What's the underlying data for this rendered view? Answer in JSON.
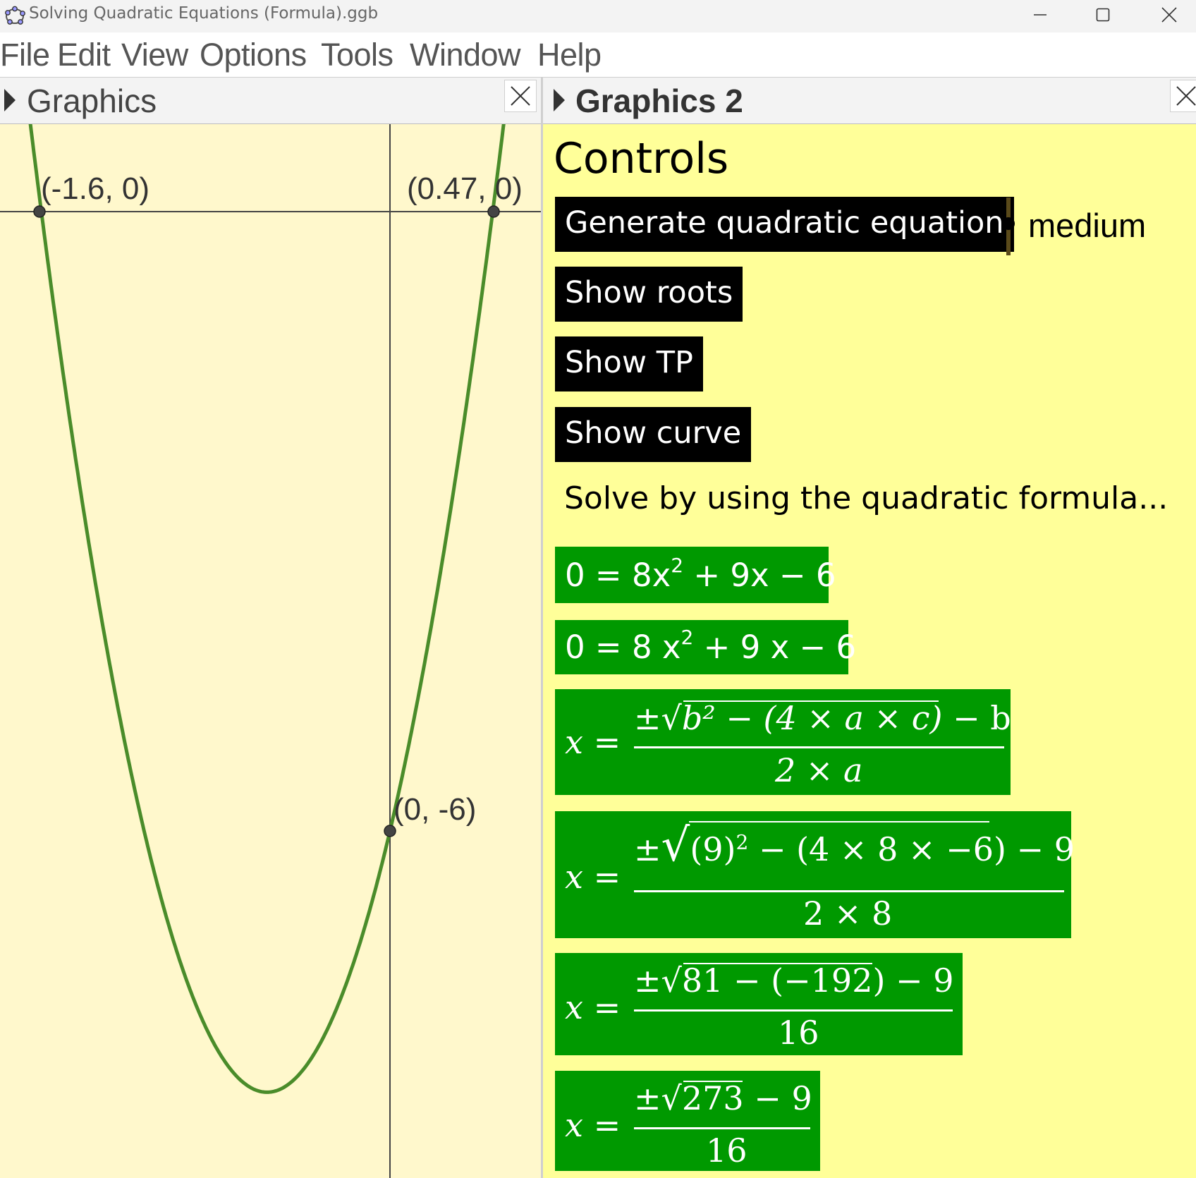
{
  "window": {
    "title": "Solving Quadratic Equations (Formula).ggb",
    "minimize_icon": "minimize-icon",
    "maximize_icon": "maximize-icon",
    "close_icon": "close-icon"
  },
  "menu": [
    "File",
    "Edit",
    "View",
    "Options",
    "Tools",
    "Window",
    "Help"
  ],
  "graphics_panel": {
    "title": "Graphics",
    "points": [
      "(-1.6, 0)",
      "(0.47, 0)",
      "(0, -6)"
    ],
    "curve_color": "#4a8c2a",
    "background": "#fff8cc"
  },
  "graphics2_panel": {
    "title": "Graphics 2",
    "heading": "Controls",
    "buttons": {
      "generate": "Generate quadratic equation",
      "roots": "Show roots",
      "tp": "Show TP",
      "curve": "Show curve"
    },
    "slider_label": "medium",
    "instruction": "Solve by using the quadratic formula...",
    "equations": {
      "eq1": {
        "lhs": "0 = 8x",
        "exp": "2",
        "rhs": " + 9x − 6"
      },
      "eq2": {
        "lhs": "0 = 8 x",
        "exp": "2",
        "rhs": " + 9 x − 6"
      },
      "f1": {
        "lhs": "x =",
        "num_pm": "±",
        "num_rad": "b² − (4 × a × c)",
        "num_tail": " − b",
        "den": "2 × a"
      },
      "f2": {
        "lhs": "x =",
        "num_pm": "±",
        "num_rad_a": "(9)",
        "num_rad_exp": "2",
        "num_rad_b": " − (4 × 8 × −6)",
        "num_tail": " − 9",
        "den": "2 × 8"
      },
      "f3": {
        "lhs": "x =",
        "num_pm": "±",
        "num_rad": "81 − (−192)",
        "num_tail": " − 9",
        "den": "16"
      },
      "f4": {
        "lhs": "x =",
        "num_pm": "±",
        "num_rad": "273",
        "num_tail": " − 9",
        "den": "16"
      }
    },
    "box_color": "#009900",
    "background": "#ffff99"
  }
}
